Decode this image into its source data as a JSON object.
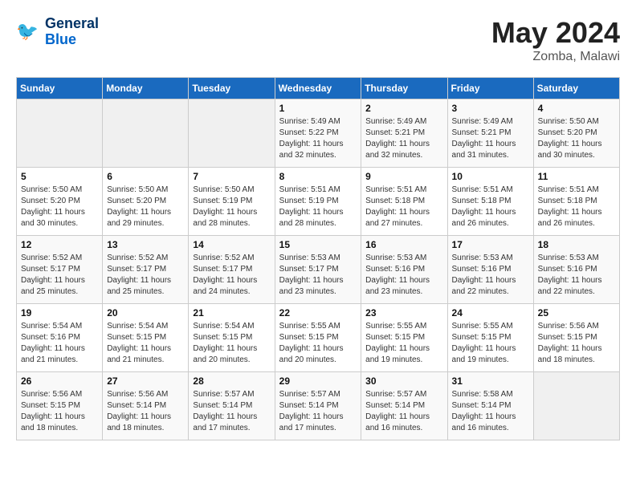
{
  "header": {
    "logo_line1": "General",
    "logo_line2": "Blue",
    "month": "May 2024",
    "location": "Zomba, Malawi"
  },
  "columns": [
    "Sunday",
    "Monday",
    "Tuesday",
    "Wednesday",
    "Thursday",
    "Friday",
    "Saturday"
  ],
  "weeks": [
    {
      "days": [
        {
          "num": "",
          "info": "",
          "empty": true
        },
        {
          "num": "",
          "info": "",
          "empty": true
        },
        {
          "num": "",
          "info": "",
          "empty": true
        },
        {
          "num": "1",
          "info": "Sunrise: 5:49 AM\nSunset: 5:22 PM\nDaylight: 11 hours\nand 32 minutes."
        },
        {
          "num": "2",
          "info": "Sunrise: 5:49 AM\nSunset: 5:21 PM\nDaylight: 11 hours\nand 32 minutes."
        },
        {
          "num": "3",
          "info": "Sunrise: 5:49 AM\nSunset: 5:21 PM\nDaylight: 11 hours\nand 31 minutes."
        },
        {
          "num": "4",
          "info": "Sunrise: 5:50 AM\nSunset: 5:20 PM\nDaylight: 11 hours\nand 30 minutes."
        }
      ]
    },
    {
      "days": [
        {
          "num": "5",
          "info": "Sunrise: 5:50 AM\nSunset: 5:20 PM\nDaylight: 11 hours\nand 30 minutes."
        },
        {
          "num": "6",
          "info": "Sunrise: 5:50 AM\nSunset: 5:20 PM\nDaylight: 11 hours\nand 29 minutes."
        },
        {
          "num": "7",
          "info": "Sunrise: 5:50 AM\nSunset: 5:19 PM\nDaylight: 11 hours\nand 28 minutes."
        },
        {
          "num": "8",
          "info": "Sunrise: 5:51 AM\nSunset: 5:19 PM\nDaylight: 11 hours\nand 28 minutes."
        },
        {
          "num": "9",
          "info": "Sunrise: 5:51 AM\nSunset: 5:18 PM\nDaylight: 11 hours\nand 27 minutes."
        },
        {
          "num": "10",
          "info": "Sunrise: 5:51 AM\nSunset: 5:18 PM\nDaylight: 11 hours\nand 26 minutes."
        },
        {
          "num": "11",
          "info": "Sunrise: 5:51 AM\nSunset: 5:18 PM\nDaylight: 11 hours\nand 26 minutes."
        }
      ]
    },
    {
      "days": [
        {
          "num": "12",
          "info": "Sunrise: 5:52 AM\nSunset: 5:17 PM\nDaylight: 11 hours\nand 25 minutes."
        },
        {
          "num": "13",
          "info": "Sunrise: 5:52 AM\nSunset: 5:17 PM\nDaylight: 11 hours\nand 25 minutes."
        },
        {
          "num": "14",
          "info": "Sunrise: 5:52 AM\nSunset: 5:17 PM\nDaylight: 11 hours\nand 24 minutes."
        },
        {
          "num": "15",
          "info": "Sunrise: 5:53 AM\nSunset: 5:17 PM\nDaylight: 11 hours\nand 23 minutes."
        },
        {
          "num": "16",
          "info": "Sunrise: 5:53 AM\nSunset: 5:16 PM\nDaylight: 11 hours\nand 23 minutes."
        },
        {
          "num": "17",
          "info": "Sunrise: 5:53 AM\nSunset: 5:16 PM\nDaylight: 11 hours\nand 22 minutes."
        },
        {
          "num": "18",
          "info": "Sunrise: 5:53 AM\nSunset: 5:16 PM\nDaylight: 11 hours\nand 22 minutes."
        }
      ]
    },
    {
      "days": [
        {
          "num": "19",
          "info": "Sunrise: 5:54 AM\nSunset: 5:16 PM\nDaylight: 11 hours\nand 21 minutes."
        },
        {
          "num": "20",
          "info": "Sunrise: 5:54 AM\nSunset: 5:15 PM\nDaylight: 11 hours\nand 21 minutes."
        },
        {
          "num": "21",
          "info": "Sunrise: 5:54 AM\nSunset: 5:15 PM\nDaylight: 11 hours\nand 20 minutes."
        },
        {
          "num": "22",
          "info": "Sunrise: 5:55 AM\nSunset: 5:15 PM\nDaylight: 11 hours\nand 20 minutes."
        },
        {
          "num": "23",
          "info": "Sunrise: 5:55 AM\nSunset: 5:15 PM\nDaylight: 11 hours\nand 19 minutes."
        },
        {
          "num": "24",
          "info": "Sunrise: 5:55 AM\nSunset: 5:15 PM\nDaylight: 11 hours\nand 19 minutes."
        },
        {
          "num": "25",
          "info": "Sunrise: 5:56 AM\nSunset: 5:15 PM\nDaylight: 11 hours\nand 18 minutes."
        }
      ]
    },
    {
      "days": [
        {
          "num": "26",
          "info": "Sunrise: 5:56 AM\nSunset: 5:15 PM\nDaylight: 11 hours\nand 18 minutes."
        },
        {
          "num": "27",
          "info": "Sunrise: 5:56 AM\nSunset: 5:14 PM\nDaylight: 11 hours\nand 18 minutes."
        },
        {
          "num": "28",
          "info": "Sunrise: 5:57 AM\nSunset: 5:14 PM\nDaylight: 11 hours\nand 17 minutes."
        },
        {
          "num": "29",
          "info": "Sunrise: 5:57 AM\nSunset: 5:14 PM\nDaylight: 11 hours\nand 17 minutes."
        },
        {
          "num": "30",
          "info": "Sunrise: 5:57 AM\nSunset: 5:14 PM\nDaylight: 11 hours\nand 16 minutes."
        },
        {
          "num": "31",
          "info": "Sunrise: 5:58 AM\nSunset: 5:14 PM\nDaylight: 11 hours\nand 16 minutes."
        },
        {
          "num": "",
          "info": "",
          "empty": true
        }
      ]
    }
  ]
}
